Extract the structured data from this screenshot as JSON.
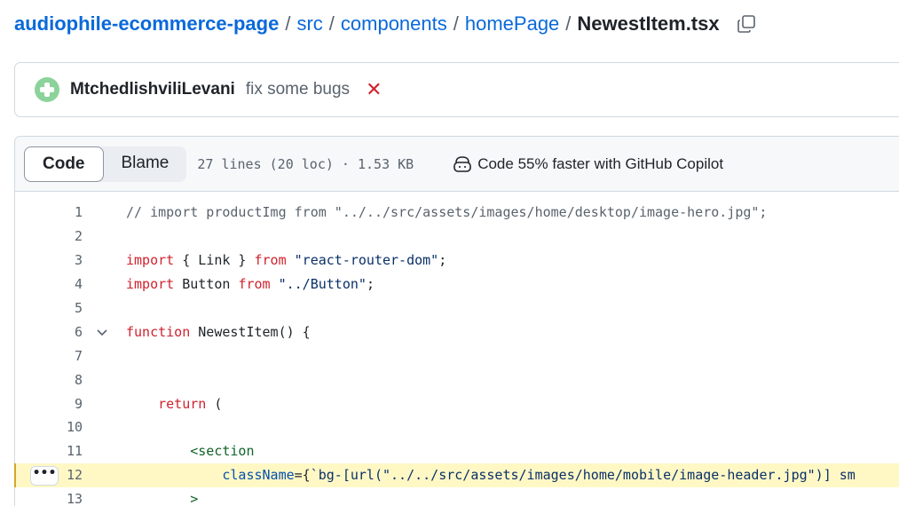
{
  "breadcrumb": {
    "repo": "audiophile-ecommerce-page",
    "segments": [
      "src",
      "components",
      "homePage"
    ],
    "separator": "/",
    "file": "NewestItem.tsx"
  },
  "commit": {
    "author": "MtchedlishviliLevani",
    "message": "fix some bugs",
    "status_icon": "x-icon",
    "status_color": "#d1242f"
  },
  "file_header": {
    "tabs": [
      "Code",
      "Blame"
    ],
    "active_tab": "Code",
    "info": "27 lines (20 loc) · 1.53 KB",
    "copilot_text": "Code 55% faster with GitHub Copilot"
  },
  "code": {
    "highlighted_line": 12,
    "line_menu_label": "•••",
    "lines": [
      {
        "num": "1",
        "tokens": [
          {
            "t": "comment",
            "v": "// import productImg from \"../../src/assets/images/home/desktop/image-hero.jpg\";"
          }
        ]
      },
      {
        "num": "2",
        "tokens": []
      },
      {
        "num": "3",
        "tokens": [
          {
            "t": "keyword",
            "v": "import"
          },
          {
            "t": "plain",
            "v": " { Link } "
          },
          {
            "t": "keyword",
            "v": "from"
          },
          {
            "t": "plain",
            "v": " "
          },
          {
            "t": "string",
            "v": "\"react-router-dom\""
          },
          {
            "t": "plain",
            "v": ";"
          }
        ]
      },
      {
        "num": "4",
        "tokens": [
          {
            "t": "keyword",
            "v": "import"
          },
          {
            "t": "plain",
            "v": " Button "
          },
          {
            "t": "keyword",
            "v": "from"
          },
          {
            "t": "plain",
            "v": " "
          },
          {
            "t": "string",
            "v": "\"../Button\""
          },
          {
            "t": "plain",
            "v": ";"
          }
        ]
      },
      {
        "num": "5",
        "tokens": []
      },
      {
        "num": "6",
        "fold": true,
        "tokens": [
          {
            "t": "keyword",
            "v": "function"
          },
          {
            "t": "plain",
            "v": " NewestItem() {"
          }
        ]
      },
      {
        "num": "7",
        "tokens": []
      },
      {
        "num": "8",
        "tokens": []
      },
      {
        "num": "9",
        "tokens": [
          {
            "t": "plain",
            "v": "    "
          },
          {
            "t": "keyword",
            "v": "return"
          },
          {
            "t": "plain",
            "v": " ("
          }
        ]
      },
      {
        "num": "10",
        "tokens": []
      },
      {
        "num": "11",
        "tokens": [
          {
            "t": "plain",
            "v": "        "
          },
          {
            "t": "tag",
            "v": "<section"
          }
        ]
      },
      {
        "num": "12",
        "tokens": [
          {
            "t": "plain",
            "v": "            "
          },
          {
            "t": "attr",
            "v": "className"
          },
          {
            "t": "plain",
            "v": "={"
          },
          {
            "t": "string",
            "v": "`bg-[url(\"../../src/assets/images/home/mobile/image-header.jpg\")] sm"
          }
        ]
      },
      {
        "num": "13",
        "tokens": [
          {
            "t": "plain",
            "v": "        "
          },
          {
            "t": "tag",
            "v": ">"
          }
        ]
      }
    ]
  }
}
